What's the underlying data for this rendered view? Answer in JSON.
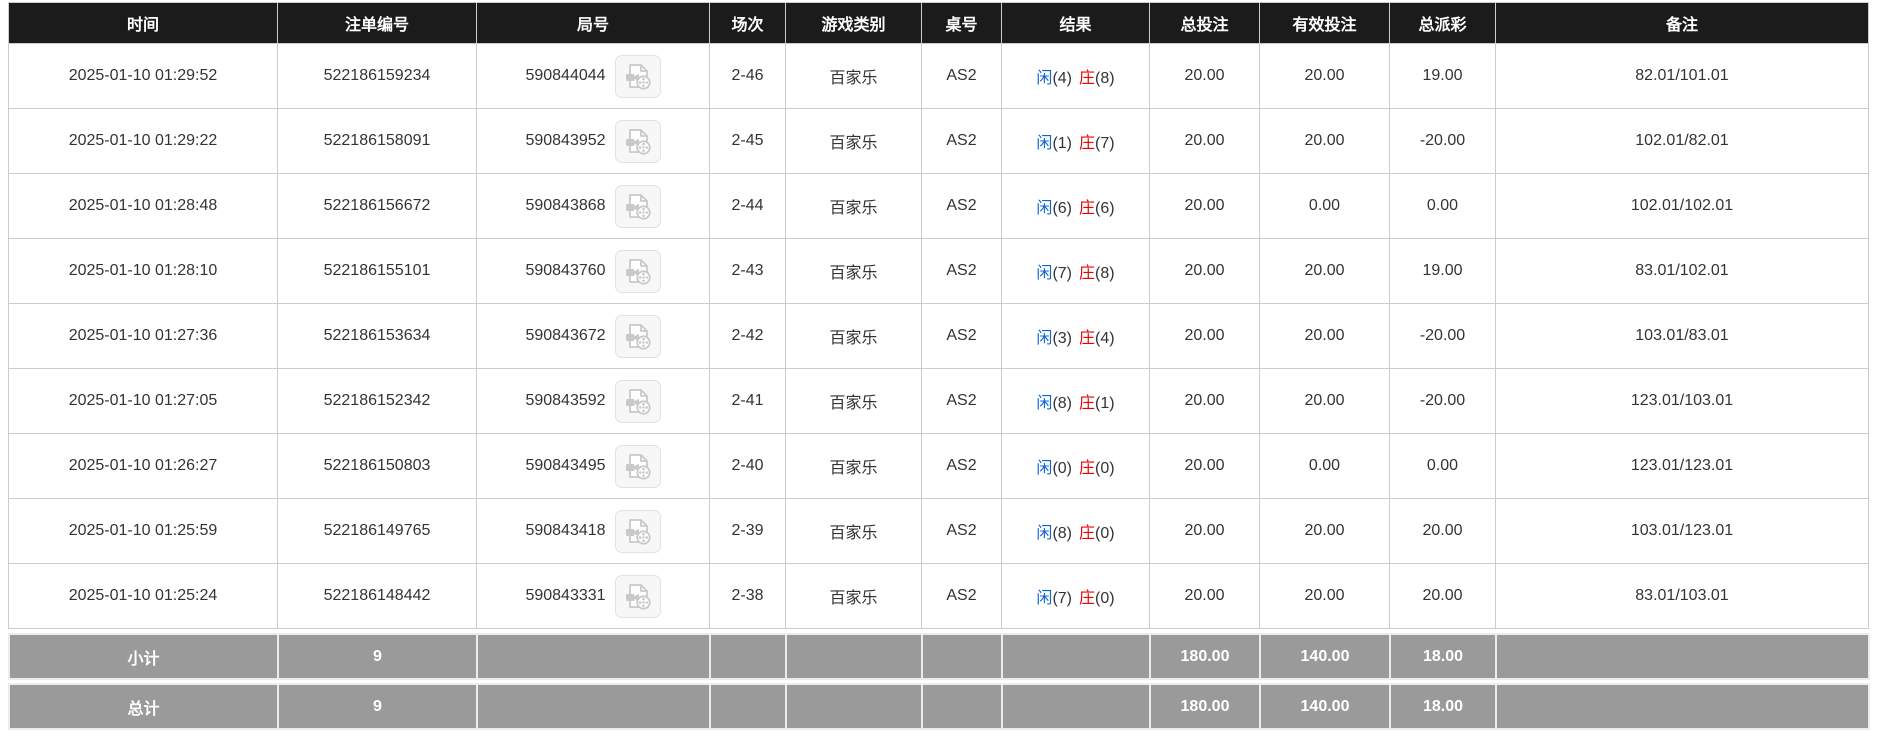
{
  "table": {
    "columns": [
      {
        "key": "time",
        "label": "时间"
      },
      {
        "key": "bet_id",
        "label": "注单编号"
      },
      {
        "key": "round_id",
        "label": "局号"
      },
      {
        "key": "session",
        "label": "场次"
      },
      {
        "key": "game_type",
        "label": "游戏类别"
      },
      {
        "key": "table_no",
        "label": "桌号"
      },
      {
        "key": "result",
        "label": "结果"
      },
      {
        "key": "total_bet",
        "label": "总投注"
      },
      {
        "key": "valid_bet",
        "label": "有效投注"
      },
      {
        "key": "total_payout",
        "label": "总派彩"
      },
      {
        "key": "remark",
        "label": "备注"
      }
    ],
    "rows": [
      {
        "time": "2025-01-10 01:29:52",
        "bet_id": "522186159234",
        "round_id": "590844044",
        "session": "2-46",
        "game_type": "百家乐",
        "table_no": "AS2",
        "result": {
          "player_label": "闲",
          "player_score": "(4)",
          "banker_label": "庄",
          "banker_score": "(8)"
        },
        "total_bet": "20.00",
        "valid_bet": "20.00",
        "total_payout": "19.00",
        "remark": "82.01/101.01",
        "highlighted": false
      },
      {
        "time": "2025-01-10 01:29:22",
        "bet_id": "522186158091",
        "round_id": "590843952",
        "session": "2-45",
        "game_type": "百家乐",
        "table_no": "AS2",
        "result": {
          "player_label": "闲",
          "player_score": "(1)",
          "banker_label": "庄",
          "banker_score": "(7)"
        },
        "total_bet": "20.00",
        "valid_bet": "20.00",
        "total_payout": "-20.00",
        "remark": "102.01/82.01",
        "highlighted": true
      },
      {
        "time": "2025-01-10 01:28:48",
        "bet_id": "522186156672",
        "round_id": "590843868",
        "session": "2-44",
        "game_type": "百家乐",
        "table_no": "AS2",
        "result": {
          "player_label": "闲",
          "player_score": "(6)",
          "banker_label": "庄",
          "banker_score": "(6)"
        },
        "total_bet": "20.00",
        "valid_bet": "0.00",
        "total_payout": "0.00",
        "remark": "102.01/102.01",
        "highlighted": false
      },
      {
        "time": "2025-01-10 01:28:10",
        "bet_id": "522186155101",
        "round_id": "590843760",
        "session": "2-43",
        "game_type": "百家乐",
        "table_no": "AS2",
        "result": {
          "player_label": "闲",
          "player_score": "(7)",
          "banker_label": "庄",
          "banker_score": "(8)"
        },
        "total_bet": "20.00",
        "valid_bet": "20.00",
        "total_payout": "19.00",
        "remark": "83.01/102.01",
        "highlighted": false
      },
      {
        "time": "2025-01-10 01:27:36",
        "bet_id": "522186153634",
        "round_id": "590843672",
        "session": "2-42",
        "game_type": "百家乐",
        "table_no": "AS2",
        "result": {
          "player_label": "闲",
          "player_score": "(3)",
          "banker_label": "庄",
          "banker_score": "(4)"
        },
        "total_bet": "20.00",
        "valid_bet": "20.00",
        "total_payout": "-20.00",
        "remark": "103.01/83.01",
        "highlighted": false
      },
      {
        "time": "2025-01-10 01:27:05",
        "bet_id": "522186152342",
        "round_id": "590843592",
        "session": "2-41",
        "game_type": "百家乐",
        "table_no": "AS2",
        "result": {
          "player_label": "闲",
          "player_score": "(8)",
          "banker_label": "庄",
          "banker_score": "(1)"
        },
        "total_bet": "20.00",
        "valid_bet": "20.00",
        "total_payout": "-20.00",
        "remark": "123.01/103.01",
        "highlighted": false
      },
      {
        "time": "2025-01-10 01:26:27",
        "bet_id": "522186150803",
        "round_id": "590843495",
        "session": "2-40",
        "game_type": "百家乐",
        "table_no": "AS2",
        "result": {
          "player_label": "闲",
          "player_score": "(0)",
          "banker_label": "庄",
          "banker_score": "(0)"
        },
        "total_bet": "20.00",
        "valid_bet": "0.00",
        "total_payout": "0.00",
        "remark": "123.01/123.01",
        "highlighted": false
      },
      {
        "time": "2025-01-10 01:25:59",
        "bet_id": "522186149765",
        "round_id": "590843418",
        "session": "2-39",
        "game_type": "百家乐",
        "table_no": "AS2",
        "result": {
          "player_label": "闲",
          "player_score": "(8)",
          "banker_label": "庄",
          "banker_score": "(0)"
        },
        "total_bet": "20.00",
        "valid_bet": "20.00",
        "total_payout": "20.00",
        "remark": "103.01/123.01",
        "highlighted": false
      },
      {
        "time": "2025-01-10 01:25:24",
        "bet_id": "522186148442",
        "round_id": "590843331",
        "session": "2-38",
        "game_type": "百家乐",
        "table_no": "AS2",
        "result": {
          "player_label": "闲",
          "player_score": "(7)",
          "banker_label": "庄",
          "banker_score": "(0)"
        },
        "total_bet": "20.00",
        "valid_bet": "20.00",
        "total_payout": "20.00",
        "remark": "83.01/103.01",
        "highlighted": false
      }
    ],
    "footer": [
      {
        "label": "小计",
        "count": "9",
        "total_bet": "180.00",
        "valid_bet": "140.00",
        "total_payout": "18.00"
      },
      {
        "label": "总计",
        "count": "9",
        "total_bet": "180.00",
        "valid_bet": "140.00",
        "total_payout": "18.00"
      }
    ]
  },
  "icons": {
    "round_video": "video-document-icon"
  },
  "colors": {
    "header_bg": "#1b1b1b",
    "header_text": "#ffffff",
    "row_text": "#333333",
    "highlight_row_bg": "#fbfbb1",
    "link_blue": "#0d63d9",
    "negative_red": "#ee0000",
    "banker_red": "#ee0000",
    "player_blue": "#0d63d9",
    "footer_bg": "#9a9a9a",
    "border": "#cccccc"
  }
}
